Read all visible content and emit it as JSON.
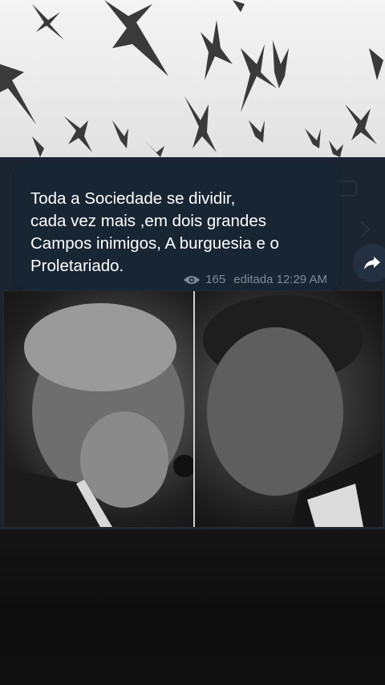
{
  "message": {
    "text": "Toda a Sociedade se dividir,\ncada vez mais ,em dois grandes\nCampos inimigos, A burguesia e o\nProletariado.",
    "views": "165",
    "status": "editada 12:29 AM"
  },
  "icons": {
    "views": "eye-icon",
    "forward": "share-arrow-icon"
  },
  "colors": {
    "bubble": "#182533",
    "meta_text": "#7d8b99",
    "wallpaper": "#1c2430"
  }
}
